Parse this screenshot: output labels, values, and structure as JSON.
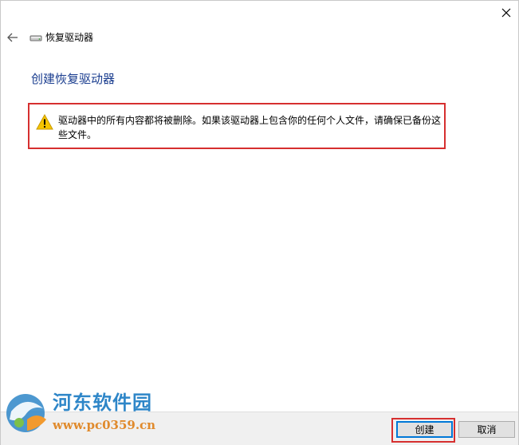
{
  "window": {
    "close_glyph": "✕"
  },
  "nav": {
    "title": "恢复驱动器"
  },
  "page": {
    "heading": "创建恢复驱动器"
  },
  "warning": {
    "text": "驱动器中的所有内容都将被删除。如果该驱动器上包含你的任何个人文件，请确保已备份这些文件。"
  },
  "buttons": {
    "create_label": "创建",
    "cancel_label": "取消"
  },
  "watermark": {
    "title": "河东软件园",
    "url": "www.pc0359.cn"
  },
  "colors": {
    "heading": "#1a3d8f",
    "highlight": "#d62f2f",
    "warning_icon": "#f5c400",
    "primary_button_border": "#0078d7"
  }
}
